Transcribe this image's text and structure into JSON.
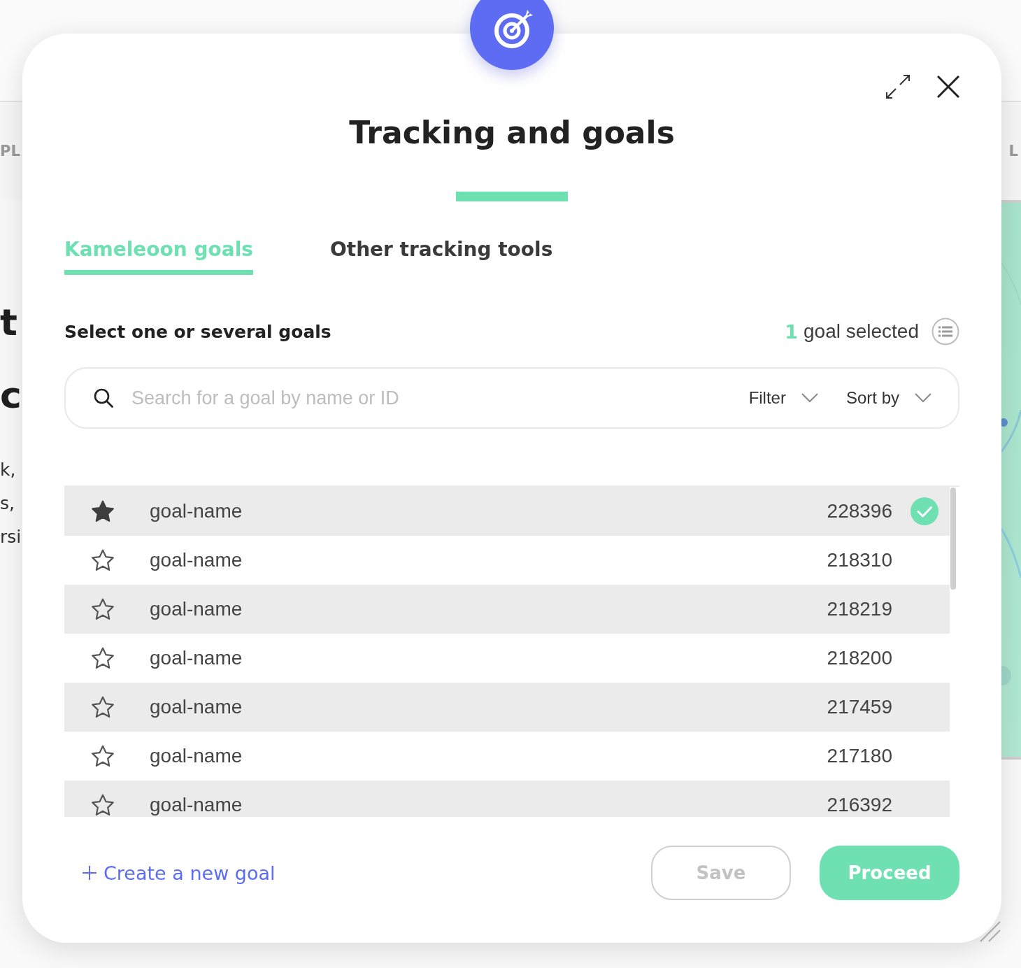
{
  "background": {
    "nav_left": "PL",
    "nav_right": "L",
    "hero_heading": [
      "t",
      "c"
    ],
    "hero_text": [
      "k,",
      "s,",
      "rsi"
    ]
  },
  "modal": {
    "title": "Tracking and goals",
    "tabs": [
      {
        "label": "Kameleoon goals",
        "selected": true
      },
      {
        "label": "Other tracking tools",
        "selected": false
      }
    ],
    "section_title": "Select one or several goals",
    "selection": {
      "count": "1",
      "label": "goal selected"
    },
    "search": {
      "placeholder": "Search for a goal by name or ID"
    },
    "dropdowns": [
      {
        "label": "Filter"
      },
      {
        "label": "Sort by"
      }
    ],
    "goals": [
      {
        "name": "goal-name",
        "id": "228396",
        "favorite": true,
        "selected": true
      },
      {
        "name": "goal-name",
        "id": "218310",
        "favorite": false,
        "selected": false
      },
      {
        "name": "goal-name",
        "id": "218219",
        "favorite": false,
        "selected": false
      },
      {
        "name": "goal-name",
        "id": "218200",
        "favorite": false,
        "selected": false
      },
      {
        "name": "goal-name",
        "id": "217459",
        "favorite": false,
        "selected": false
      },
      {
        "name": "goal-name",
        "id": "217180",
        "favorite": false,
        "selected": false
      },
      {
        "name": "goal-name",
        "id": "216392",
        "favorite": false,
        "selected": false
      }
    ],
    "create_link": "Create a new goal",
    "buttons": [
      {
        "label": "Save",
        "kind": "outline",
        "disabled": true
      },
      {
        "label": "Proceed",
        "kind": "primary",
        "disabled": false
      }
    ]
  }
}
